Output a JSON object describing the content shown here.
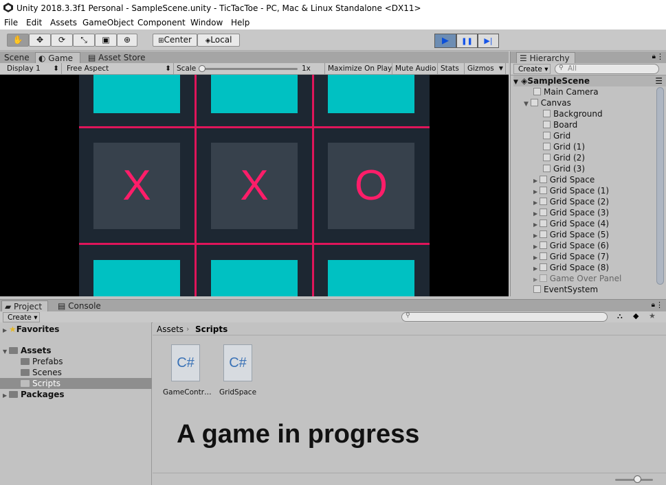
{
  "window": {
    "title": "Unity 2018.3.3f1 Personal - SampleScene.unity - TicTacToe - PC, Mac & Linux Standalone <DX11>"
  },
  "menu": [
    "File",
    "Edit",
    "Assets",
    "GameObject",
    "Component",
    "Window",
    "Help"
  ],
  "toolbar": {
    "pivot_label": "Center",
    "space_label": "Local",
    "play_icon": "▶",
    "pause_icon": "❚❚",
    "step_icon": "▶|"
  },
  "scene_tabs": {
    "scene": "Scene",
    "game": "Game",
    "asset_store": "Asset Store"
  },
  "game_toolbar": {
    "display": "Display 1",
    "aspect": "Free Aspect",
    "scale_label": "Scale",
    "scale_value": "1x",
    "maximize": "Maximize On Play",
    "mute": "Mute Audio",
    "stats": "Stats",
    "gizmos": "Gizmos"
  },
  "game_board": {
    "marks": [
      "X",
      "X",
      "O"
    ]
  },
  "hierarchy": {
    "tab": "Hierarchy",
    "create": "Create",
    "search_placeholder": "All",
    "scene": "SampleScene",
    "items": [
      "Main Camera",
      "Canvas",
      "Background",
      "Board",
      "Grid",
      "Grid (1)",
      "Grid (2)",
      "Grid (3)",
      "Grid Space",
      "Grid Space (1)",
      "Grid Space (2)",
      "Grid Space (3)",
      "Grid Space (4)",
      "Grid Space (5)",
      "Grid Space (6)",
      "Grid Space (7)",
      "Grid Space (8)",
      "Game Over Panel",
      "EventSystem"
    ]
  },
  "project": {
    "tabs": {
      "project": "Project",
      "console": "Console"
    },
    "create": "Create",
    "tree": {
      "favorites": "Favorites",
      "assets": "Assets",
      "prefabs": "Prefabs",
      "scenes": "Scenes",
      "scripts": "Scripts",
      "packages": "Packages"
    },
    "breadcrumb": {
      "root": "Assets",
      "current": "Scripts"
    },
    "files": [
      {
        "name": "GameContr…",
        "ext": "C#"
      },
      {
        "name": "GridSpace",
        "ext": "C#"
      }
    ]
  },
  "caption": "A game in progress",
  "colors": {
    "cyan": "#00c1c2",
    "mark": "#ff1d69",
    "board": "#1d2732",
    "cell": "#37414c"
  }
}
